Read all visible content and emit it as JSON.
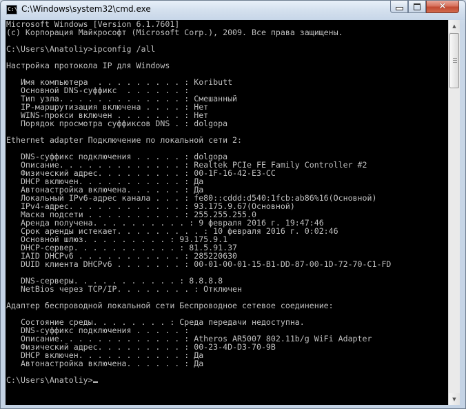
{
  "window": {
    "title": "C:\\Windows\\system32\\cmd.exe",
    "icon": "cmd-icon",
    "icon_text": "C:\\"
  },
  "controls": {
    "minimize_icon": "minimize-icon",
    "maximize_icon": "maximize-icon",
    "close_glyph": "✕"
  },
  "console": {
    "lines": [
      "Microsoft Windows [Version 6.1.7601]",
      "(c) Корпорация Майкрософт (Microsoft Corp.), 2009. Все права защищены.",
      "",
      "C:\\Users\\Anatoliy>ipconfig /all",
      "",
      "Настройка протокола IP для Windows",
      "",
      "   Имя компьютера  . . . . . . . . . : Koributt",
      "   Основной DNS-суффикс  . . . . . . :",
      "   Тип узла. . . . . . . . . . . . . : Смешанный",
      "   IP-маршрутизация включена . . . . : Нет",
      "   WINS-прокси включен . . . . . . . : Нет",
      "   Порядок просмотра суффиксов DNS . : dolgopa",
      "",
      "Ethernet adapter Подключение по локальной сети 2:",
      "",
      "   DNS-суффикс подключения . . . . . : dolgopa",
      "   Описание. . . . . . . . . . . . . : Realtek PCIe FE Family Controller #2",
      "   Физический адрес. . . . . . . . . : 00-1F-16-42-E3-CC",
      "   DHCP включен. . . . . . . . . . . : Да",
      "   Автонастройка включена. . . . . . : Да",
      "   Локальный IPv6-адрес канала . . . : fe80::cddd:d540:1fcb:ab86%16(Основной)",
      "   IPv4-адрес. . . . . . . . . . . . : 93.175.9.67(Основной)",
      "   Маска подсети . . . . . . . . . . : 255.255.255.0",
      "   Аренда получена. . . . . . . . . . : 9 февраля 2016 г. 19:47:46",
      "   Срок аренды истекает. . . . . . . . . : 10 февраля 2016 г. 0:02:46",
      "   Основной шлюз. . . . . . . . . : 93.175.9.1",
      "   DHCP-сервер. . . . . . . . . . . : 81.5.91.37",
      "   IAID DHCPv6 . . . . . . . . . . . : 285220630",
      "   DUID клиента DHCPv6 . . . . . . . : 00-01-00-01-15-B1-DD-87-00-1D-72-70-C1-FD",
      "",
      "   DNS-серверы. . . . . . . . . . . : 8.8.8.8",
      "   NetBios через TCP/IP. . . . . . . . : Отключен",
      "",
      "Адаптер беспроводной локальной сети Беспроводное сетевое соединение:",
      "",
      "   Состояние среды. . . . . . . . : Среда передачи недоступна.",
      "   DNS-суффикс подключения . . . . . :",
      "   Описание. . . . . . . . . . . . . : Atheros AR5007 802.11b/g WiFi Adapter",
      "   Физический адрес. . . . . . . . . : 00-23-4D-D3-70-9B",
      "   DHCP включен. . . . . . . . . . . : Да",
      "   Автонастройка включена. . . . . . : Да",
      "",
      "C:\\Users\\Anatoliy>"
    ]
  },
  "scrollbar": {
    "up_arrow": "▲",
    "down_arrow": "▼"
  }
}
